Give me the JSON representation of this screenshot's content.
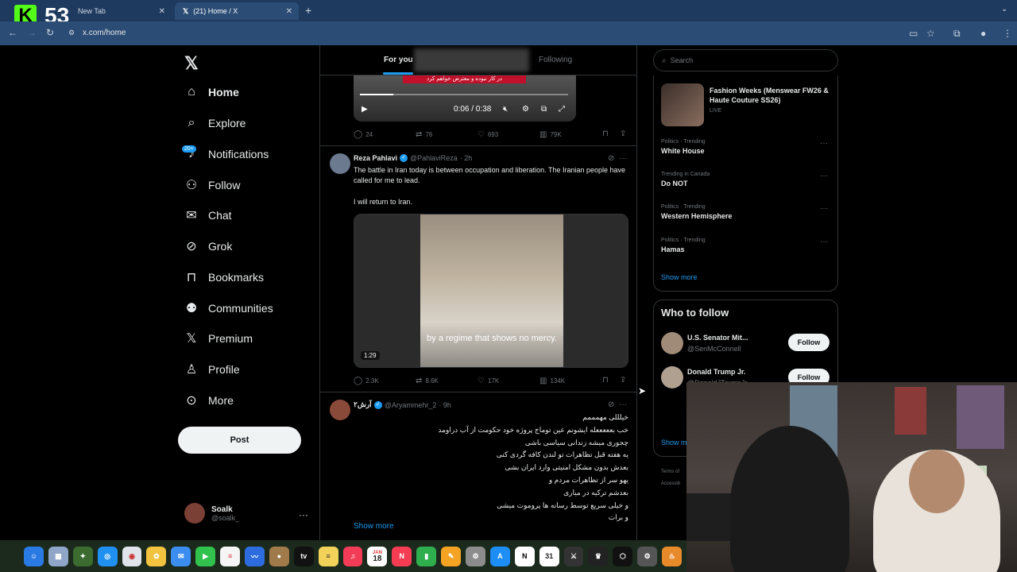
{
  "browser": {
    "tabs": [
      {
        "label": "New Tab"
      },
      {
        "label": "(21) Home / X"
      }
    ],
    "url": "x.com/home",
    "kick_count": "53"
  },
  "nav": {
    "items": [
      {
        "icon": "home-icon",
        "label": "Home"
      },
      {
        "icon": "search-icon",
        "label": "Explore"
      },
      {
        "icon": "bell-icon",
        "label": "Notifications"
      },
      {
        "icon": "follow-icon",
        "label": "Follow"
      },
      {
        "icon": "mail-icon",
        "label": "Chat"
      },
      {
        "icon": "grok-icon",
        "label": "Grok"
      },
      {
        "icon": "bookmark-icon",
        "label": "Bookmarks"
      },
      {
        "icon": "communities-icon",
        "label": "Communities"
      },
      {
        "icon": "x-icon",
        "label": "Premium"
      },
      {
        "icon": "person-icon",
        "label": "Profile"
      },
      {
        "icon": "more-circle-icon",
        "label": "More"
      }
    ],
    "notifications_badge": "20+",
    "post_label": "Post",
    "profile": {
      "name": "Soalk",
      "handle": "@soalk_"
    }
  },
  "timeline": {
    "tabs": {
      "for_you": "For you",
      "following": "Following"
    },
    "video_top": {
      "time": "0:06 / 0:38",
      "banner": "در کار نبوده و معترض خواهم کرد",
      "progress": 0.16
    },
    "tweet0_actions": {
      "replies": "24",
      "reposts": "76",
      "likes": "693",
      "views": "79K"
    },
    "tweet1": {
      "name": "Reza Pahlavi",
      "handle": "@PahlaviReza",
      "time": "· 2h",
      "text1": "The battle in Iran today is between occupation and liberation. The Iranian people have called for me to lead.",
      "text2": "I will return to Iran.",
      "video_subtitle": "by a regime that shows no mercy.",
      "video_duration": "1:29",
      "actions": {
        "replies": "2.3K",
        "reposts": "8.6K",
        "likes": "17K",
        "views": "134K"
      }
    },
    "tweet2": {
      "name": "آرش۲",
      "handle": "@Aryammehr_2",
      "time": "· 9h",
      "lines": [
        "خیلللی مهمممم",
        "خب بعععععله ایشونم عین توماج پروژه خود حکومت از آب دراومد",
        "چجوری میشه زندانی سیاسی باشی",
        "یه هفته قبل تظاهرات تو لندن کافه گردی کنی",
        "بعدش بدون مشکل امنیتی وارد ایران بشی",
        "یهو سر از تظاهرات مردم و",
        "بعدشم ترکیه در میاری",
        "و خیلی سریع توسط رسانه ها پروموت میشی",
        "و برات"
      ],
      "show_more": "Show more"
    }
  },
  "sidebar": {
    "search_placeholder": "Search",
    "featured": {
      "title": "Fashion Weeks (Menswear FW26 & Haute Couture SS26)",
      "status": "LIVE"
    },
    "trends": [
      {
        "category": "Politics · Trending",
        "title": "White House"
      },
      {
        "category": "Trending in Canada",
        "title": "Do NOT"
      },
      {
        "category": "Politics · Trending",
        "title": "Western Hemisphere"
      },
      {
        "category": "Politics · Trending",
        "title": "Hamas"
      }
    ],
    "show_more": "Show more",
    "who_to_follow": {
      "title": "Who to follow",
      "accounts": [
        {
          "name": "U.S. Senator Mit...",
          "handle": "@SenMcConnell",
          "button": "Follow"
        },
        {
          "name": "Donald Trump Jr.",
          "handle": "@DonaldJTrumpJr",
          "button": "Follow"
        }
      ],
      "show_more": "Show m"
    },
    "footer": {
      "terms": "Terms of",
      "access": "Accessib"
    }
  },
  "dock": {
    "icons": [
      "finder-icon",
      "launchpad-icon",
      "app-icon",
      "safari-icon",
      "chrome-icon",
      "photos-icon",
      "mail-icon",
      "facetime-icon",
      "reminders-icon",
      "freeform-icon",
      "app-icon",
      "appletv-icon",
      "notes-icon",
      "music-icon",
      "calendar-icon",
      "news-icon",
      "numbers-icon",
      "pages-icon",
      "settings-icon",
      "appstore-icon",
      "notion-icon",
      "calendar-icon",
      "app-icon",
      "app-icon",
      "app-icon",
      "app-icon",
      "app-icon"
    ],
    "calendar_day": "18",
    "calendar_month": "JAN",
    "calendar_day2": "31"
  }
}
